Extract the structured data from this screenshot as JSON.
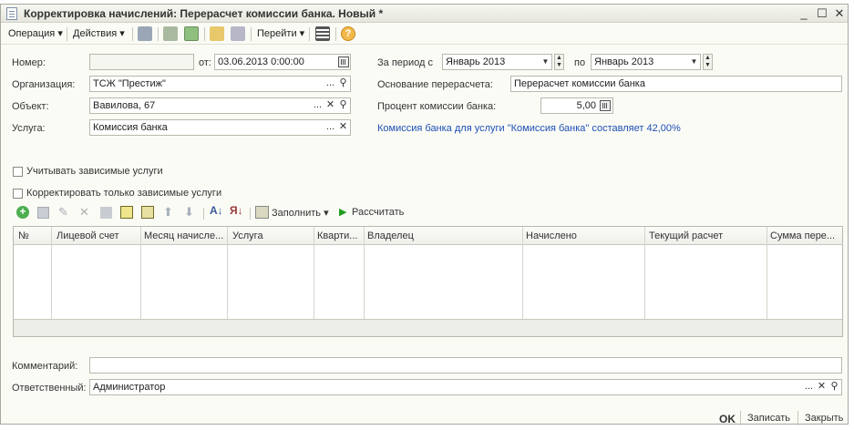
{
  "window": {
    "title": "Корректировка начислений: Перерасчет комиссии банка. Новый *",
    "minimize_glyph": "_",
    "maximize_glyph": "☐",
    "close_glyph": "✕"
  },
  "toolbar": {
    "operation_label": "Операция",
    "actions_label": "Действия",
    "goto_label": "Перейти",
    "help_glyph": "?"
  },
  "form": {
    "number_label": "Номер:",
    "number_value": "",
    "from_label": "от:",
    "date_value": "03.06.2013  0:00:00",
    "period_label": "За период с",
    "period_from": "Январь 2013",
    "period_to_label": "по",
    "period_to": "Январь 2013",
    "org_label": "Организация:",
    "org_value": "ТСЖ \"Престиж\"",
    "basis_label": "Основание перерасчета:",
    "basis_value": "Перерасчет комиссии банка",
    "object_label": "Объект:",
    "object_value": "Вавилова, 67",
    "percent_label": "Процент комиссии банка:",
    "percent_value": "5,00",
    "service_label": "Услуга:",
    "service_value": "Комиссия банка",
    "info_text": "Комиссия банка для услуги \"Комиссия банка\" составляет 42,00%",
    "dots_glyph": "...",
    "clear_glyph": "✕",
    "search_glyph": "⚲",
    "spin_up": "▲",
    "spin_down": "▼",
    "dropdown_glyph": "▼"
  },
  "checkboxes": {
    "dependent_label": "Учитывать зависимые услуги",
    "only_dependent_label": "Корректировать только зависимые услуги"
  },
  "table_toolbar": {
    "fill_label": "Заполнить",
    "calculate_label": "Рассчитать"
  },
  "table": {
    "columns": [
      "№",
      "Лицевой счет",
      "Месяц начисле...",
      "Услуга",
      "Кварти...",
      "Владелец",
      "Начислено",
      "Текущий расчет",
      "Сумма пере..."
    ]
  },
  "bottom": {
    "comment_label": "Комментарий:",
    "comment_value": "",
    "responsible_label": "Ответственный:",
    "responsible_value": "Администратор",
    "ok_label": "OK",
    "save_label": "Записать",
    "close_label": "Закрыть"
  },
  "colors": {
    "link": "#1c4fb5",
    "add_icon": "#4caf50",
    "run_icon": "#1f9e1f",
    "help": "#f2b94a"
  }
}
